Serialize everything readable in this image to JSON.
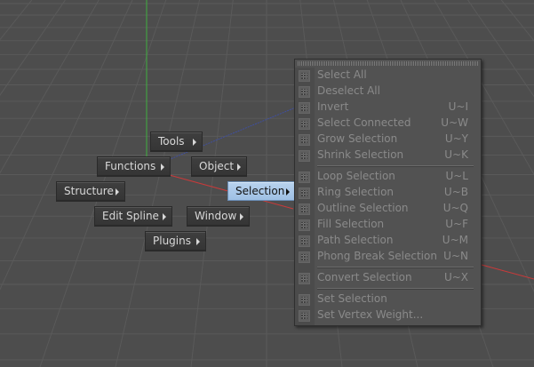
{
  "hud": {
    "tools": "Tools",
    "functions": "Functions",
    "object": "Object",
    "structure": "Structure",
    "selection": "Selection",
    "edit_spline": "Edit Spline",
    "window": "Window",
    "plugins": "Plugins"
  },
  "submenu": {
    "groups": [
      [
        {
          "label": "Select All",
          "shortcut": "",
          "icon": "select-all-icon"
        },
        {
          "label": "Deselect All",
          "shortcut": "",
          "icon": "deselect-all-icon"
        },
        {
          "label": "Invert",
          "shortcut": "U~I",
          "icon": "invert-icon"
        },
        {
          "label": "Select Connected",
          "shortcut": "U~W",
          "icon": "select-connected-icon"
        },
        {
          "label": "Grow Selection",
          "shortcut": "U~Y",
          "icon": "grow-selection-icon"
        },
        {
          "label": "Shrink Selection",
          "shortcut": "U~K",
          "icon": "shrink-selection-icon"
        }
      ],
      [
        {
          "label": "Loop Selection",
          "shortcut": "U~L",
          "icon": "loop-selection-icon"
        },
        {
          "label": "Ring Selection",
          "shortcut": "U~B",
          "icon": "ring-selection-icon"
        },
        {
          "label": "Outline Selection",
          "shortcut": "U~Q",
          "icon": "outline-selection-icon"
        },
        {
          "label": "Fill Selection",
          "shortcut": "U~F",
          "icon": "fill-selection-icon"
        },
        {
          "label": "Path Selection",
          "shortcut": "U~M",
          "icon": "path-selection-icon"
        },
        {
          "label": "Phong Break Selection",
          "shortcut": "U~N",
          "icon": "phong-break-selection-icon"
        }
      ],
      [
        {
          "label": "Convert Selection",
          "shortcut": "U~X",
          "icon": "convert-selection-icon"
        }
      ],
      [
        {
          "label": "Set Selection",
          "shortcut": "",
          "icon": "set-selection-icon"
        },
        {
          "label": "Set Vertex Weight...",
          "shortcut": "",
          "icon": "set-vertex-weight-icon"
        }
      ]
    ]
  },
  "colors": {
    "background": "#4d4d4d",
    "grid_line": "#5a5a5a",
    "y_axis": "#3fae3f",
    "x_axis": "#c83a3a",
    "z_axis": "#3f4fa0",
    "active_item": "#aac8ea",
    "disabled_text": "#8a8a8a"
  }
}
